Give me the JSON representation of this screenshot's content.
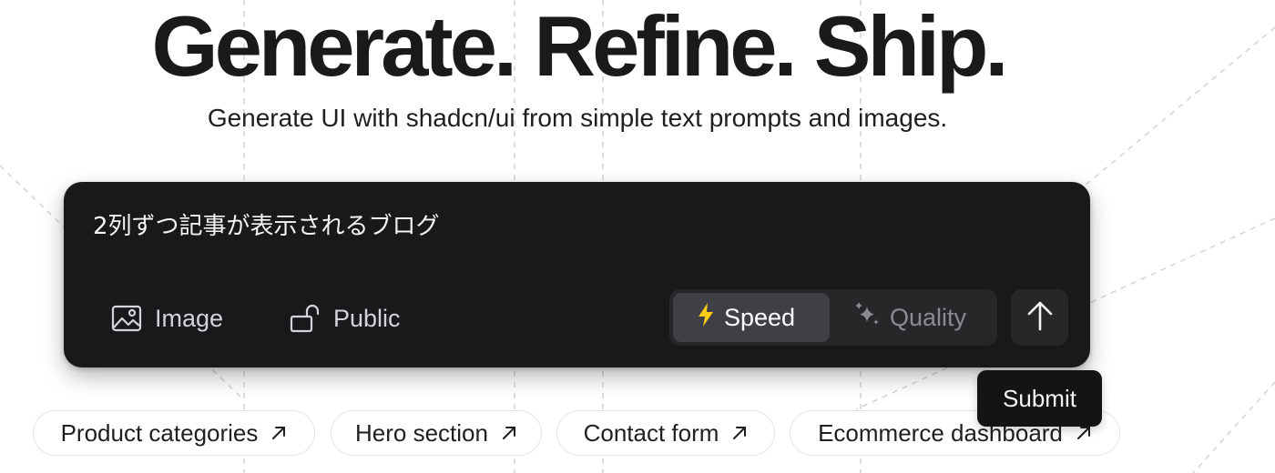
{
  "hero": {
    "title": "Generate. Refine. Ship.",
    "subtitle": "Generate UI with shadcn/ui from simple text prompts and images."
  },
  "prompt": {
    "value": "2列ずつ記事が表示されるブログ",
    "image_label": "Image",
    "image_icon": "image-icon",
    "visibility_label": "Public",
    "visibility_icon": "unlock-icon",
    "modes": [
      {
        "label": "Speed",
        "icon": "lightning-icon",
        "selected": true
      },
      {
        "label": "Quality",
        "icon": "sparkles-icon",
        "selected": false
      }
    ],
    "submit_icon": "arrow-up-icon",
    "submit_tooltip": "Submit"
  },
  "suggestions": [
    {
      "label": "Product categories",
      "icon": "arrow-up-right-icon"
    },
    {
      "label": "Hero section",
      "icon": "arrow-up-right-icon"
    },
    {
      "label": "Contact form",
      "icon": "arrow-up-right-icon"
    },
    {
      "label": "Ecommerce dashboard",
      "icon": "arrow-up-right-icon"
    }
  ],
  "colors": {
    "prompt_bg": "#19191b",
    "selected_mode_bg": "#3f3f46",
    "speed_icon": "#facc15",
    "hero_text": "#1a1a1a"
  }
}
